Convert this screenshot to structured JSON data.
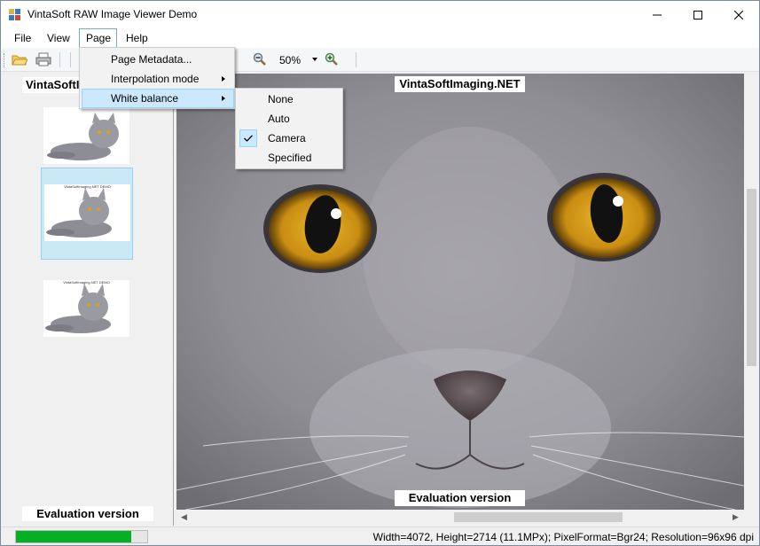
{
  "window": {
    "title": "VintaSoft RAW Image Viewer Demo",
    "controls": {
      "minimize": "—",
      "maximize": "☐",
      "close": "✕"
    }
  },
  "menubar": {
    "items": [
      {
        "label": "File"
      },
      {
        "label": "View"
      },
      {
        "label": "Page"
      },
      {
        "label": "Help"
      }
    ]
  },
  "toolbar": {
    "zoom": "50%",
    "icons": [
      "open-folder-icon",
      "print-icon",
      "zoom-out-icon",
      "zoom-in-icon"
    ]
  },
  "page_menu": {
    "items": [
      {
        "label": "Page Metadata..."
      },
      {
        "label": "Interpolation mode"
      },
      {
        "label": "White balance"
      }
    ]
  },
  "white_balance_menu": {
    "items": [
      {
        "label": "None",
        "checked": false
      },
      {
        "label": "Auto",
        "checked": false
      },
      {
        "label": "Camera",
        "checked": true
      },
      {
        "label": "Specified",
        "checked": false
      }
    ]
  },
  "thumbnails": {
    "header": "VintaSoftImaging.NET",
    "footer": "Evaluation version",
    "items": [
      {
        "caption": "",
        "selected": false
      },
      {
        "caption": "VintaSoftImaging.NET DEMO",
        "selected": true
      },
      {
        "caption": "VintaSoftImaging.NET DEMO",
        "selected": false
      }
    ]
  },
  "viewer": {
    "watermark_top": "VintaSoftImaging.NET",
    "watermark_bottom": "Evaluation version"
  },
  "statusbar": {
    "progress": 0.88,
    "info": "Width=4072, Height=2714 (11.1MPx); PixelFormat=Bgr24; Resolution=96x96 dpi"
  },
  "colors": {
    "progress": "#06b025",
    "highlight": "#cce8ff",
    "selected_thumb": "#cbe8f6",
    "eye": "#d9a21b"
  }
}
